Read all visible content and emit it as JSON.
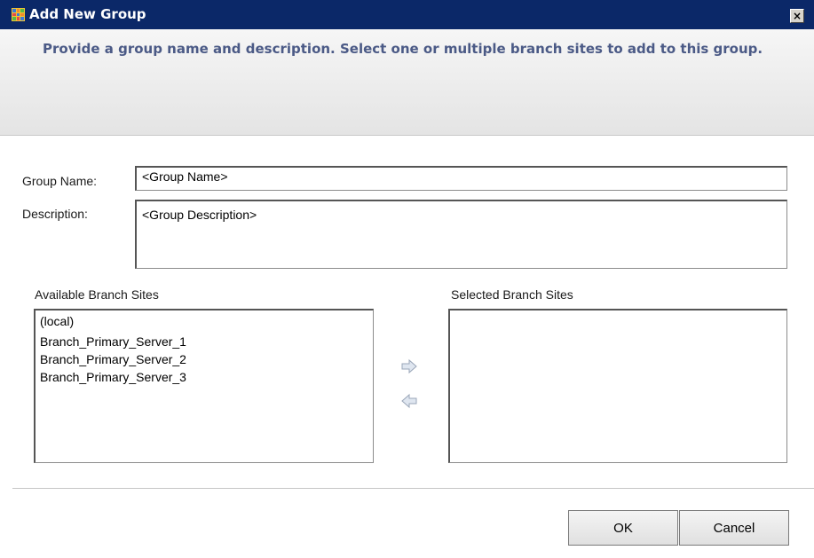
{
  "window": {
    "title": "Add New Group",
    "app_icon": "grid-app-icon",
    "close_label": "×"
  },
  "header": {
    "instruction": "Provide a group name and description. Select one or multiple branch sites to add to this group."
  },
  "form": {
    "group_name_label": "Group Name:",
    "group_name_value": "<Group Name>",
    "description_label": "Description:",
    "description_value": "<Group Description>"
  },
  "available": {
    "label": "Available Branch Sites",
    "items": [
      "(local)",
      "Branch_Primary_Server_1",
      "Branch_Primary_Server_2",
      "Branch_Primary_Server_3"
    ]
  },
  "selected": {
    "label": "Selected Branch Sites",
    "items": []
  },
  "transfer": {
    "add_icon": "arrow-right-icon",
    "remove_icon": "arrow-left-icon"
  },
  "buttons": {
    "ok": "OK",
    "cancel": "Cancel"
  },
  "colors": {
    "titlebar": "#0b2868",
    "header_text": "#4b5a86",
    "header_bg": "#e8e8e8"
  }
}
